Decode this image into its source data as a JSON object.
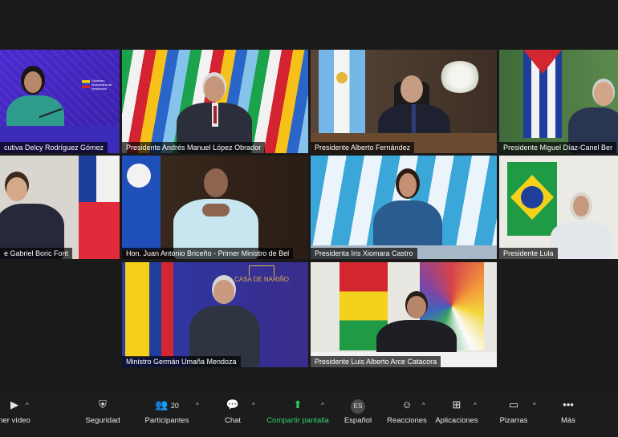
{
  "tiles": [
    {
      "name": "cutiva Delcy Rodríguez Gómez"
    },
    {
      "name": "Presidente Andrés Manuel López Obrador"
    },
    {
      "name": "Presidente Alberto Fernández"
    },
    {
      "name": "Presidente Miguel Díaz-Canel Ber"
    },
    {
      "name": "e Gabriel Boric Font"
    },
    {
      "name": "Hon. Juan Antonio Briceño - Primer Ministro de Bel"
    },
    {
      "name": "Presidenta Iris Xiomara Castro"
    },
    {
      "name": "Presidente Lula"
    },
    {
      "name": "Ministro Germán Umaña Mendoza"
    },
    {
      "name": "Presidente Luis Alberto Arce Catacora"
    }
  ],
  "logo_text": "Gobierno Bolivariano de Venezuela",
  "casa_text": "CASA DE NARIÑO",
  "toolbar": {
    "video": "ner vídeo",
    "security": "Seguridad",
    "participants": "Participantes",
    "participants_count": "20",
    "chat": "Chat",
    "share": "Compartir pantalla",
    "language": "Español",
    "language_badge": "ES",
    "reactions": "Reacciones",
    "apps": "Aplicaciones",
    "whiteboards": "Pizarras",
    "more": "Más"
  },
  "colors": {
    "accent": "#2fd16b",
    "active_border": "#d6d94a"
  }
}
